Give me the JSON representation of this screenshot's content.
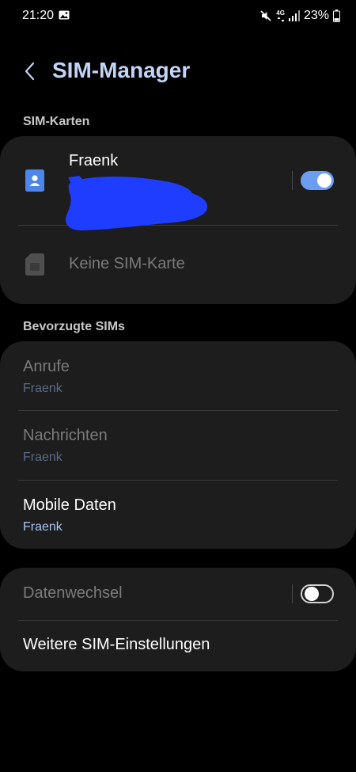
{
  "status_bar": {
    "time": "21:20",
    "network": "4G",
    "battery": "23%"
  },
  "header": {
    "title": "SIM-Manager"
  },
  "sim_cards": {
    "section_label": "SIM-Karten",
    "sim1": {
      "name": "Fraenk",
      "enabled": true
    },
    "sim2": {
      "label": "Keine SIM-Karte"
    }
  },
  "preferred": {
    "section_label": "Bevorzugte SIMs",
    "items": [
      {
        "title": "Anrufe",
        "value": "Fraenk",
        "enabled": false
      },
      {
        "title": "Nachrichten",
        "value": "Fraenk",
        "enabled": false
      },
      {
        "title": "Mobile Daten",
        "value": "Fraenk",
        "enabled": true
      }
    ]
  },
  "other": {
    "data_switch": {
      "label": "Datenwechsel",
      "enabled": false
    },
    "more_settings": {
      "label": "Weitere SIM-Einstellungen"
    }
  },
  "colors": {
    "accent": "#6b9df1",
    "title": "#c3d4f6",
    "card": "#1d1d1d",
    "redaction": "#1f3dff"
  }
}
